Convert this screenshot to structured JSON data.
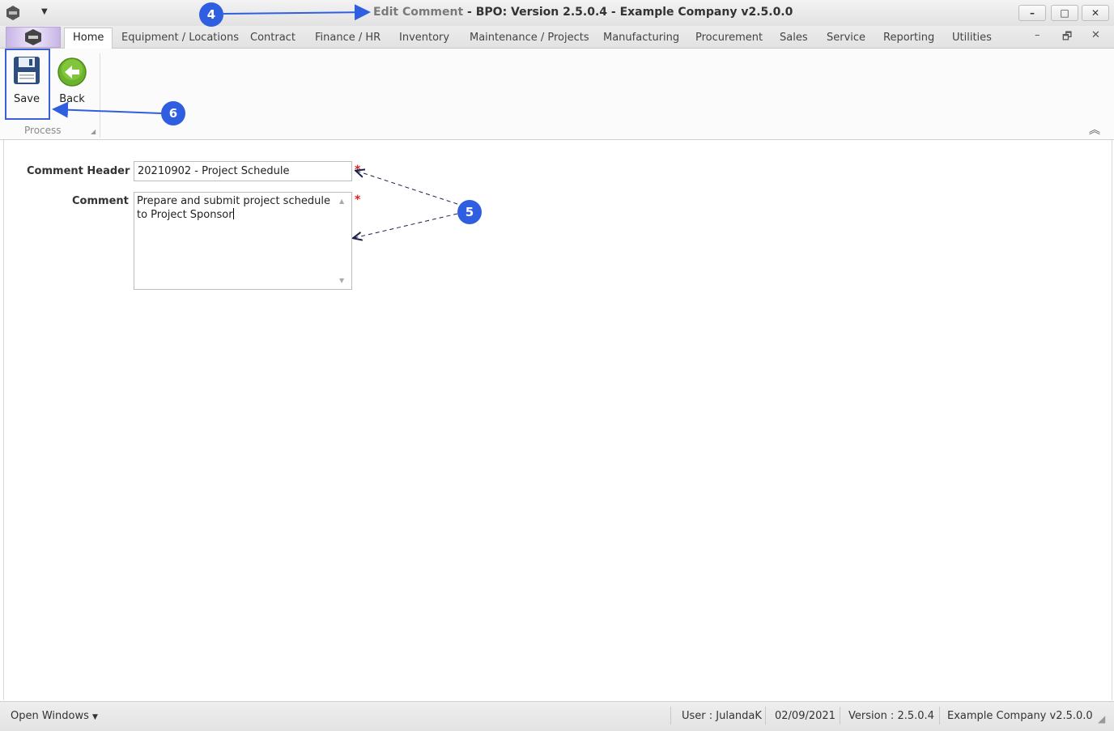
{
  "window": {
    "title_prefix": "Edit Comment",
    "title_rest": " - BPO: Version 2.5.0.4 - Example Company v2.5.0.0",
    "minimize": "–",
    "maximize": "□",
    "close": "✕",
    "qat_icon": "chevron-down-icon"
  },
  "tabs": [
    {
      "label": "Home",
      "active": true
    },
    {
      "label": "Equipment / Locations"
    },
    {
      "label": "Contract"
    },
    {
      "label": "Finance / HR"
    },
    {
      "label": "Inventory"
    },
    {
      "label": "Maintenance / Projects"
    },
    {
      "label": "Manufacturing"
    },
    {
      "label": "Procurement"
    },
    {
      "label": "Sales"
    },
    {
      "label": "Service"
    },
    {
      "label": "Reporting"
    },
    {
      "label": "Utilities"
    }
  ],
  "mdi": {
    "minimize": "–",
    "restore": "🗗",
    "close": "✕"
  },
  "ribbon": {
    "save_label": "Save",
    "back_label": "Back",
    "group_label": "Process",
    "collapse_icon": "double-chevron-up-icon"
  },
  "form": {
    "comment_header_label": "Comment Header",
    "comment_header_value": "20210902 - Project Schedule",
    "comment_label": "Comment",
    "comment_value": "Prepare and submit project schedule to Project Sponsor",
    "required_marker": "*"
  },
  "callouts": {
    "c4": "4",
    "c5": "5",
    "c6": "6"
  },
  "status": {
    "open_windows": "Open Windows",
    "user": "User : JulandaK",
    "date": "02/09/2021",
    "version": "Version : 2.5.0.4",
    "company": "Example Company v2.5.0.0"
  },
  "colors": {
    "accent": "#2f5fe0",
    "required": "#e02020"
  }
}
